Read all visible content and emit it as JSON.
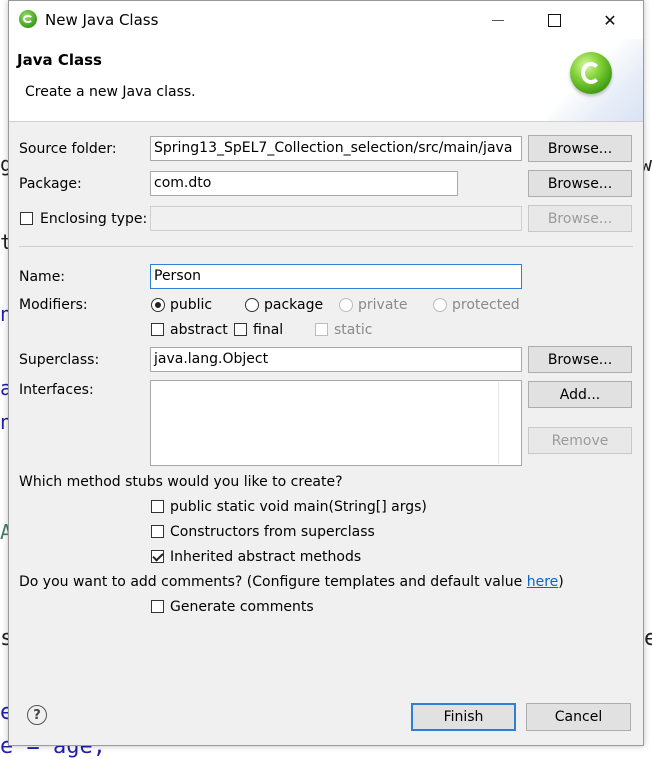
{
  "window": {
    "title": "New Java Class"
  },
  "header": {
    "title": "Java Class",
    "description": "Create a new Java class."
  },
  "source_folder": {
    "label": "Source folder:",
    "value": "Spring13_SpEL7_Collection_selection/src/main/java",
    "browse": "Browse..."
  },
  "package": {
    "label": "Package:",
    "value": "com.dto",
    "browse": "Browse..."
  },
  "enclosing": {
    "label": "Enclosing type:",
    "value": "",
    "browse": "Browse..."
  },
  "name": {
    "label": "Name:",
    "value": "Person"
  },
  "modifiers": {
    "label": "Modifiers:",
    "public": "public",
    "package": "package",
    "private": "private",
    "protected": "protected",
    "abstract": "abstract",
    "final": "final",
    "static": "static"
  },
  "superclass": {
    "label": "Superclass:",
    "value": "java.lang.Object",
    "browse": "Browse..."
  },
  "interfaces": {
    "label": "Interfaces:",
    "add": "Add...",
    "remove": "Remove"
  },
  "stubs": {
    "question": "Which method stubs would you like to create?",
    "main": "public static void main(String[] args)",
    "constructors": "Constructors from superclass",
    "inherited": "Inherited abstract methods"
  },
  "comments": {
    "question": "Do you want to add comments? (Configure templates and default value ",
    "link": "here",
    "close": ")",
    "generate": "Generate comments"
  },
  "footer": {
    "finish": "Finish",
    "cancel": "Cancel",
    "help_symbol": "?"
  },
  "background": {
    "f1": "g",
    "f2": "w",
    "f3": "t",
    "f4": "na",
    "f5": "al",
    "f6": "nt",
    "f7": "A",
    "f8": "st",
    "f9": "e",
    "f10": "el",
    "f11": "e = age;"
  },
  "colors": {
    "accent": "#2f7fd6",
    "link": "#0b63c8",
    "dialog_bg": "#f0f0f0"
  }
}
